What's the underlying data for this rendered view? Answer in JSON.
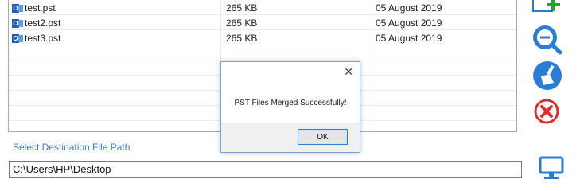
{
  "files": [
    {
      "icon": "outlook-pst-icon",
      "name": "test.pst",
      "size": "265 KB",
      "date": "05 August 2019"
    },
    {
      "icon": "outlook-pst-icon",
      "name": "test2.pst",
      "size": "265 KB",
      "date": "05 August 2019"
    },
    {
      "icon": "outlook-pst-icon",
      "name": "test3.pst",
      "size": "265 KB",
      "date": "05 August 2019"
    }
  ],
  "toolbar": {
    "add_icon": "add-icon",
    "search_icon": "search-icon",
    "clean_icon": "broom-icon",
    "remove_icon": "remove-icon"
  },
  "destination": {
    "label": "Select Destination File Path",
    "path": "C:\\Users\\HP\\Desktop",
    "browse_icon": "monitor-icon"
  },
  "dialog": {
    "message": "PST Files Merged Successfully!",
    "ok_label": "OK",
    "close_glyph": "✕"
  },
  "colors": {
    "accent_blue": "#2a7dd3",
    "label_blue": "#3a7ec6",
    "add_green": "#27a327",
    "remove_red": "#d93030"
  }
}
